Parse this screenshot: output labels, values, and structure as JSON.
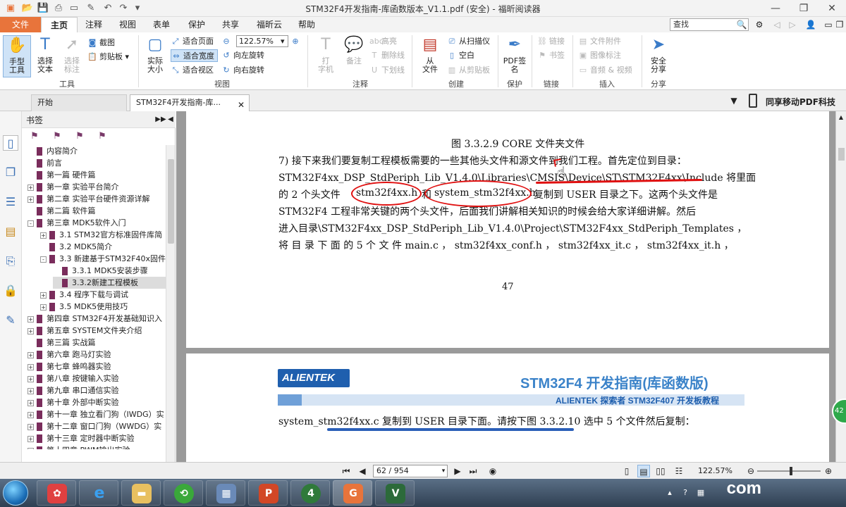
{
  "window": {
    "title": "STM32F4开发指南-库函数版本_V1.1.pdf (安全) - 福昕阅读器"
  },
  "menu": {
    "file": "文件",
    "items": [
      "主页",
      "注释",
      "视图",
      "表单",
      "保护",
      "共享",
      "福昕云",
      "帮助"
    ]
  },
  "search": {
    "value": "查找"
  },
  "ribbon": {
    "tools": {
      "hand": "手型\n工具",
      "select_text": "选择\n文本",
      "select_annot": "选择\n标注",
      "screenshot": "截图",
      "clipboard": "剪贴板",
      "group": "工具"
    },
    "view": {
      "actual_size": "实际\n大小",
      "fit_page": "适合页面",
      "fit_width": "适合宽度",
      "fit_visible": "适合视区",
      "zoom_value": "122.57%",
      "rotate_left": "向左旋转",
      "rotate_right": "向右旋转",
      "group": "视图"
    },
    "comment": {
      "typewriter": "打\n字机",
      "note": "备注",
      "highlight": "高亮",
      "strikeout": "删除线",
      "underline": "下划线",
      "group": "注释"
    },
    "create": {
      "from_file": "从\n文件",
      "from_scanner": "从扫描仪",
      "blank": "空白",
      "from_clipboard": "从剪贴板",
      "group": "创建"
    },
    "protect": {
      "pdf_sign": "PDF签\n名",
      "group": "保护"
    },
    "links": {
      "link": "链接",
      "bookmark": "书签",
      "group": "链接"
    },
    "insert": {
      "file_attachment": "文件附件",
      "image_annotation": "图像标注",
      "audio_video": "音频 & 视频",
      "group": "插入"
    },
    "share": {
      "secure_share": "安全\n分享",
      "group": "分享"
    }
  },
  "tabs": {
    "start": "开始",
    "doc": "STM32F4开发指南-库...",
    "promo": "同享移动PDF科技"
  },
  "bookmarks": {
    "title": "书签",
    "items": [
      {
        "label": "内容简介",
        "indent": 0,
        "exp": ""
      },
      {
        "label": "前言",
        "indent": 0,
        "exp": ""
      },
      {
        "label": "第一篇 硬件篇",
        "indent": 0,
        "exp": ""
      },
      {
        "label": "第一章 实验平台简介",
        "indent": 0,
        "exp": "+"
      },
      {
        "label": "第二章 实验平台硬件资源详解",
        "indent": 0,
        "exp": "+"
      },
      {
        "label": "第二篇 软件篇",
        "indent": 0,
        "exp": ""
      },
      {
        "label": "第三章 MDK5软件入门",
        "indent": 0,
        "exp": "-"
      },
      {
        "label": "3.1 STM32官方标准固件库简",
        "indent": 1,
        "exp": "+"
      },
      {
        "label": "3.2 MDK5简介",
        "indent": 1,
        "exp": ""
      },
      {
        "label": "3.3 新建基于STM32F40x固件",
        "indent": 1,
        "exp": "-"
      },
      {
        "label": "3.3.1 MDK5安装步骤",
        "indent": 2,
        "exp": ""
      },
      {
        "label": "3.3.2新建工程模板",
        "indent": 2,
        "exp": ""
      },
      {
        "label": "3.4 程序下载与调试",
        "indent": 1,
        "exp": "+"
      },
      {
        "label": "3.5 MDK5使用技巧",
        "indent": 1,
        "exp": "+"
      },
      {
        "label": "第四章 STM32F4开发基础知识入",
        "indent": 0,
        "exp": "+"
      },
      {
        "label": "第五章 SYSTEM文件夹介绍",
        "indent": 0,
        "exp": "+"
      },
      {
        "label": "第三篇 实战篇",
        "indent": 0,
        "exp": ""
      },
      {
        "label": "第六章 跑马灯实验",
        "indent": 0,
        "exp": "+"
      },
      {
        "label": "第七章 蜂鸣器实验",
        "indent": 0,
        "exp": "+"
      },
      {
        "label": "第八章 按键输入实验",
        "indent": 0,
        "exp": "+"
      },
      {
        "label": "第九章 串口通信实验",
        "indent": 0,
        "exp": "+"
      },
      {
        "label": "第十章 外部中断实验",
        "indent": 0,
        "exp": "+"
      },
      {
        "label": "第十一章 独立看门狗（IWDG）实",
        "indent": 0,
        "exp": "+"
      },
      {
        "label": "第十二章 窗口门狗（WWDG）实",
        "indent": 0,
        "exp": "+"
      },
      {
        "label": "第十三章 定时器中断实验",
        "indent": 0,
        "exp": "+"
      },
      {
        "label": "第十四章 PWM输出实验",
        "indent": 0,
        "exp": "+"
      }
    ]
  },
  "document": {
    "page1": {
      "caption": "图 3.3.2.9 CORE 文件夹文件",
      "line1": "7)    接下来我们要复制工程模板需要的一些其他头文件和源文件到我们工程。首先定位到目录：",
      "line2": "STM32F4xx_DSP_StdPeriph_Lib_V1.4.0\\Libraries\\CMSIS\\Device\\ST\\STM32F4xx\\Include  将里面",
      "line3a": "的 2 个头文件",
      "file1": "stm32f4xx.h",
      "line3b": "和",
      "file2": "system_stm32f4xx.h",
      "line3c": "复制到  USER  目录之下。这两个头文件是",
      "line4": "STM32F4 工程非常关键的两个头文件，后面我们讲解相关知识的时候会给大家详细讲解。然后",
      "line5": "进入目录\\STM32F4xx_DSP_StdPeriph_Lib_V1.4.0\\Project\\STM32F4xx_StdPeriph_Templates ，",
      "line6": "将 目 录 下 面 的   5   个 文 件    main.c ，  stm32f4xx_conf.h ，  stm32f4xx_it.c ，  stm32f4xx_it.h ，",
      "page_number": "47"
    },
    "page2": {
      "logo": "ALIENTEK",
      "header_title": "STM32F4 开发指南(库函数版)",
      "header_sub": "ALIENTEK 探索者 STM32F407 开发板教程",
      "line1": "system_stm32f4xx.c 复制到 USER 目录下面。请按下图 3.3.2.10 选中 5 个文件然后复制："
    }
  },
  "navbar": {
    "page_value": "62 / 954",
    "zoom": "122.57%"
  },
  "taskbar": {
    "bg_text": "com"
  },
  "colors": {
    "accent": "#e8743b",
    "annotation": "#e01010",
    "alientek_blue": "#1f5fae"
  }
}
